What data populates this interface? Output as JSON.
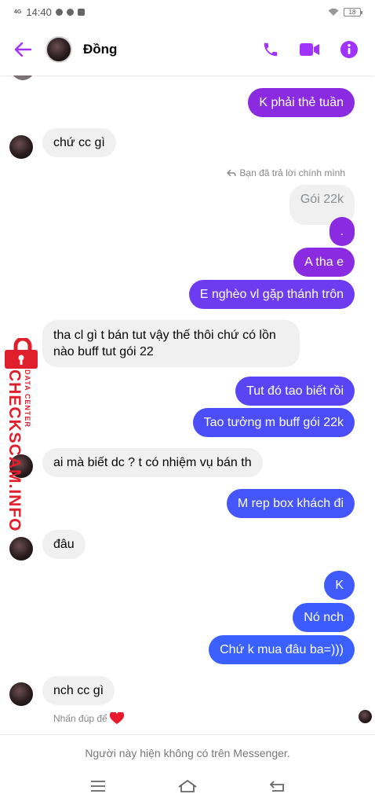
{
  "status_bar": {
    "network": "4G",
    "time": "14:40",
    "battery": "18"
  },
  "header": {
    "contact_name": "Đồng"
  },
  "colors": {
    "accent": "#a033ff",
    "bubble_purple": "#8a2be2",
    "bubble_blue": "#3d5cff",
    "incoming": "#f0f0f0"
  },
  "messages": [
    {
      "dir": "out",
      "text": "K phải thẻ tuần"
    },
    {
      "dir": "in",
      "text": "chứ cc gì"
    },
    {
      "note": "Bạn đã trả lời chính mình"
    },
    {
      "dir": "reply",
      "text": "Gói 22k"
    },
    {
      "dir": "out",
      "text": "."
    },
    {
      "dir": "out",
      "text": "A tha e"
    },
    {
      "dir": "out",
      "text": "E nghèo vl gặp thánh trôn"
    },
    {
      "dir": "in",
      "text": "tha cl gì t bán tut vậy thế thôi chứ có lồn nào buff tut gói 22"
    },
    {
      "dir": "out",
      "text": "Tut đó tao biết rồi"
    },
    {
      "dir": "out",
      "text": "Tao tưởng m buff gói 22k"
    },
    {
      "dir": "in",
      "text": "ai mà biết dc ? t có nhiệm vụ bán th"
    },
    {
      "dir": "out",
      "text": "M rep box khách đi"
    },
    {
      "dir": "in",
      "text": "đâu"
    },
    {
      "dir": "out",
      "text": "K"
    },
    {
      "dir": "out",
      "text": "Nó nch"
    },
    {
      "dir": "out",
      "text": "Chứ k mua đâu ba=)))"
    },
    {
      "dir": "in",
      "text": "nch cc gì"
    }
  ],
  "hint": {
    "text": "Nhấn đúp để",
    "icon": "heart-icon"
  },
  "footer": {
    "text": "Người này hiện không có trên Messenger."
  },
  "watermark": {
    "main": "CHECKSCAM.INFO",
    "sub": "DATA CENTER"
  },
  "icons": [
    "back-arrow-icon",
    "phone-icon",
    "video-call-icon",
    "info-icon",
    "reply-icon",
    "heart-icon",
    "menu-icon",
    "home-icon",
    "back-nav-icon"
  ]
}
